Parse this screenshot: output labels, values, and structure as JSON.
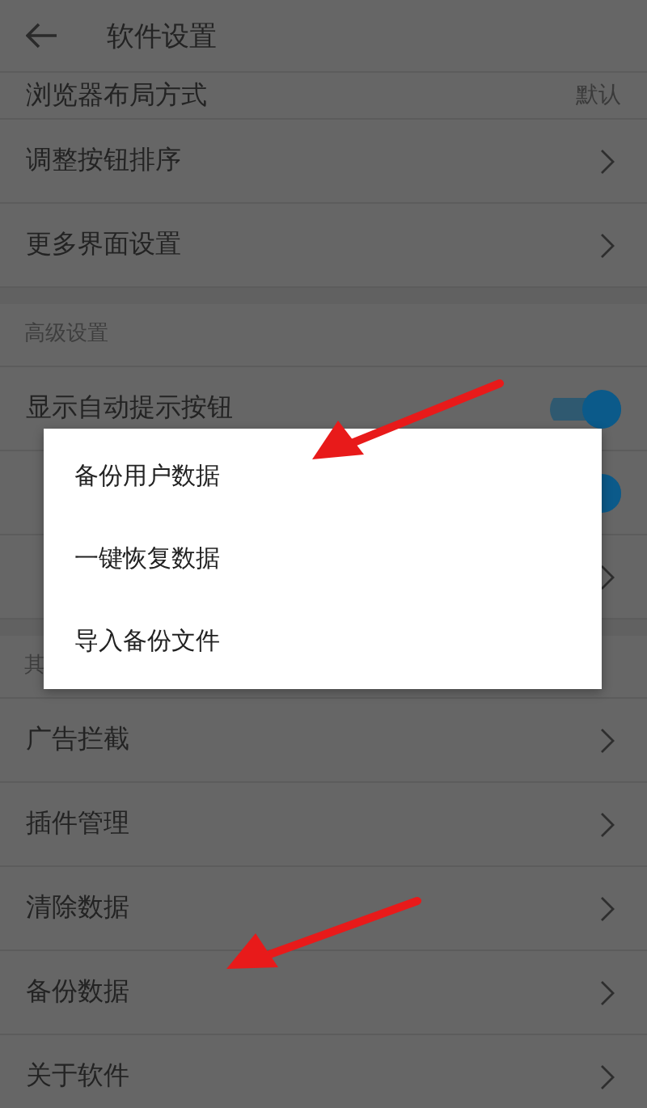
{
  "header": {
    "title": "软件设置"
  },
  "sections": [
    {
      "items": [
        {
          "kind": "value",
          "label": "浏览器布局方式",
          "value": "默认"
        },
        {
          "kind": "chevron",
          "label": "调整按钮排序"
        },
        {
          "kind": "chevron",
          "label": "更多界面设置"
        }
      ]
    },
    {
      "title": "高级设置",
      "items": [
        {
          "kind": "toggle",
          "label": "显示自动提示按钮",
          "on": true
        },
        {
          "kind": "toggle",
          "on": true
        },
        {
          "kind": "chevron"
        }
      ]
    },
    {
      "title": "其",
      "items": [
        {
          "kind": "chevron",
          "label": "广告拦截"
        },
        {
          "kind": "chevron",
          "label": "插件管理"
        },
        {
          "kind": "chevron",
          "label": "清除数据"
        },
        {
          "kind": "chevron",
          "label": "备份数据"
        },
        {
          "kind": "chevron",
          "label": "关于软件"
        }
      ]
    }
  ],
  "dialog": {
    "items": [
      "备份用户数据",
      "一键恢复数据",
      "导入备份文件"
    ]
  }
}
